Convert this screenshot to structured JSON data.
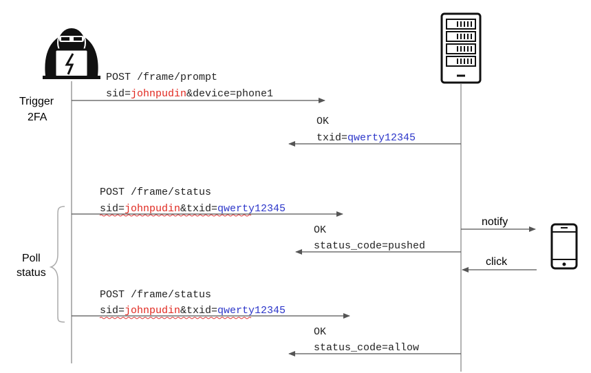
{
  "labels": {
    "trigger_line1": "Trigger",
    "trigger_line2": "2FA",
    "poll_line1": "Poll",
    "poll_line2": "status",
    "notify": "notify",
    "click": "click"
  },
  "messages": {
    "m1": {
      "line1": "POST /frame/prompt",
      "sid_key": "sid=",
      "sid_val": "johnpudin",
      "rest": "&device=phone1"
    },
    "m2": {
      "line1": "OK",
      "key": "txid=",
      "val": "qwerty12345"
    },
    "m3": {
      "line1": "POST /frame/status",
      "sid_key": "sid=",
      "sid_val": "johnpudin",
      "tx_key": "&txid=",
      "tx_val": "qwerty12345"
    },
    "m4": {
      "line1": "OK",
      "line2": "status_code=pushed"
    },
    "m5": {
      "line1": "POST /frame/status",
      "sid_key": "sid=",
      "sid_val": "johnpudin",
      "tx_key": "&txid=",
      "tx_val": "qwerty12345"
    },
    "m6": {
      "line1": "OK",
      "line2": "status_code=allow"
    }
  },
  "colors": {
    "highlight_red": "#e0281f",
    "highlight_blue": "#2b35c9"
  },
  "icons": {
    "client": "hacker-laptop-icon",
    "server": "server-rack-icon",
    "device": "smartphone-icon"
  }
}
